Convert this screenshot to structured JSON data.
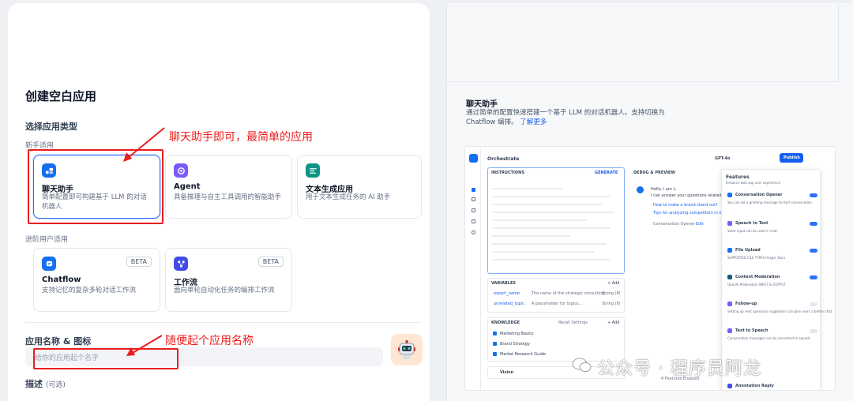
{
  "form": {
    "title": "创建空白应用",
    "type_section": "选择应用类型",
    "beginner_label": "新手适用",
    "advanced_label": "进阶用户适用",
    "name_label": "应用名称 & 图标",
    "name_placeholder": "给你的应用起个名字",
    "desc_label": "描述",
    "desc_optional": "(可选)"
  },
  "cards": [
    {
      "title": "聊天助手",
      "desc": "简单配置即可构建基于 LLM 的对话机器人",
      "icon": "chat-bot-icon",
      "color": "#1570ef"
    },
    {
      "title": "Agent",
      "desc": "具备推理与自主工具调用的智能助手",
      "icon": "agent-icon",
      "color": "#7a5af8"
    },
    {
      "title": "文本生成应用",
      "desc": "用于文本生成任务的 AI 助手",
      "icon": "text-gen-icon",
      "color": "#0e9384"
    },
    {
      "title": "Chatflow",
      "desc": "支持记忆的复杂多轮对话工作流",
      "icon": "chatflow-icon",
      "color": "#1570ef",
      "badge": "BETA"
    },
    {
      "title": "工作流",
      "desc": "面向单轮自动化任务的编排工作流",
      "icon": "workflow-icon",
      "color": "#444ce7",
      "badge": "BETA"
    }
  ],
  "annotations": {
    "card_note": "聊天助手即可，最简单的应用",
    "name_note": "随便起个应用名称"
  },
  "preview": {
    "title": "聊天助手",
    "desc": "通过简单的配置快速搭建一个基于 LLM 的对话机器人。支持切换为 Chatflow 编排。",
    "link": "了解更多",
    "orchestrate": "Orchestrate",
    "instructions": "INSTRUCTIONS",
    "generate": "GENERATE",
    "debug": "DEBUG & PREVIEW",
    "model": "GPT-4o",
    "publish": "Publish",
    "variables": "VARIABLES",
    "knowledge": "KNOWLEDGE",
    "add": "+ Add",
    "recall": "Recall Settings",
    "var_rows": [
      {
        "key": "expert_name",
        "desc": "The name of the strategic consulting...",
        "type": "String (8)"
      },
      {
        "key": "unrelated_topic",
        "desc": "A placeholder for topics...",
        "type": "String (8)"
      }
    ],
    "knowledge_rows": [
      "Marketing Basics",
      "Brand Strategy",
      "Market Research Guide"
    ],
    "vision": "Vision",
    "chat_greeting": "Hello, I am L.",
    "chat_line": "I can answer your questions related",
    "suggest1": "How to make a brand stand out?",
    "suggest2": "Tips for analyzing competitors in market",
    "opener_note": "Conversation Opener",
    "edit": "Edit",
    "features_title": "Features",
    "features_sub": "Enhance web app user experience",
    "features": [
      {
        "name": "Conversation Opener",
        "desc": "You can set a greeting message to start conversation",
        "color": "#1570ef",
        "on": true
      },
      {
        "name": "Speech to Text",
        "desc": "Voice input can be used in chat.",
        "color": "#7a5af8",
        "on": true
      },
      {
        "name": "File Upload",
        "desc": "SUPPORTED FILE TYPES  Image, Docs",
        "color": "#1570ef",
        "on": true
      },
      {
        "name": "Content Moderation",
        "desc": "OpenAI Moderation  INPUT & OUTPUT",
        "color": "#155b75",
        "on": true
      },
      {
        "name": "Follow-up",
        "desc": "Setting up next questions suggestion can give users a better chat.",
        "color": "#7a5af8",
        "on": false
      },
      {
        "name": "Text to Speech",
        "desc": "Conversation messages can be converted to speech.",
        "color": "#7a5af8",
        "on": false
      },
      {
        "name": "Annotation Reply",
        "desc": "",
        "color": "#444ce7",
        "on": false
      }
    ],
    "features_enabled": "4 Features Enabled"
  },
  "watermark": "公众号 · 程序员阿龙"
}
